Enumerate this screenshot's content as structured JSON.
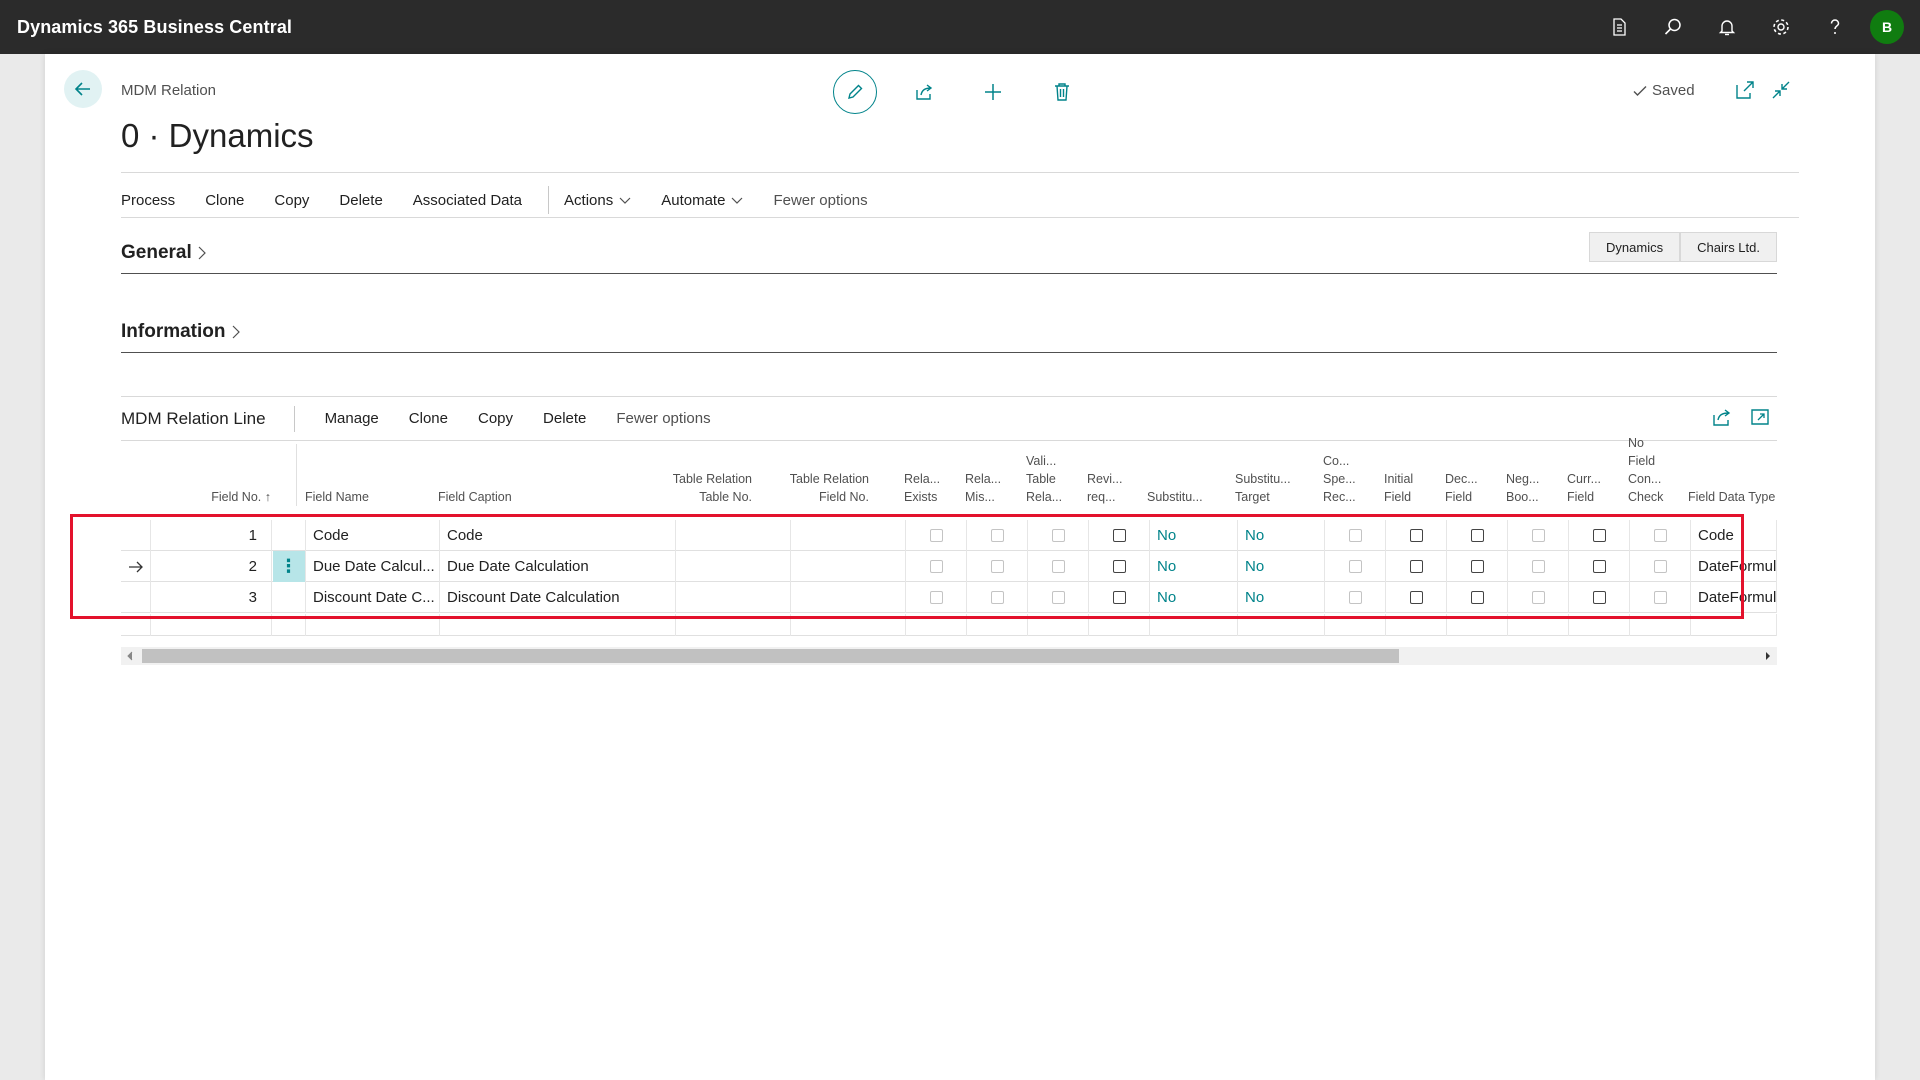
{
  "app": {
    "title": "Dynamics 365 Business Central",
    "user_initial": "B"
  },
  "appbar_icons": [
    "document-icon",
    "search-icon",
    "bell-icon",
    "gear-icon",
    "help-icon"
  ],
  "page": {
    "caption": "MDM Relation",
    "title": "0 · Dynamics",
    "status": "Saved"
  },
  "actions": [
    "Process",
    "Clone",
    "Copy",
    "Delete",
    "Associated Data"
  ],
  "menus": {
    "actions": "Actions",
    "automate": "Automate",
    "fewer": "Fewer options"
  },
  "sections": {
    "general": "General",
    "information": "Information"
  },
  "companies": [
    "Dynamics",
    "Chairs Ltd."
  ],
  "lines": {
    "title": "MDM Relation Line",
    "actions": [
      "Manage",
      "Clone",
      "Copy",
      "Delete"
    ],
    "fewer": "Fewer options",
    "headers": {
      "field_no": "Field No.",
      "field_name": "Field Name",
      "field_caption": "Field Caption",
      "tr_table_1": "Table Relation",
      "tr_table_2": "Table No.",
      "tr_field_1": "Table Relation",
      "tr_field_2": "Field No.",
      "rel_exists_1": "Rela...",
      "rel_exists_2": "Exists",
      "rel_mis_1": "Rela...",
      "rel_mis_2": "Mis...",
      "vali_1": "Vali...",
      "vali_2": "Table",
      "vali_3": "Rela...",
      "revi_1": "Revi...",
      "revi_2": "req...",
      "substitu": "Substitu...",
      "subst_target_1": "Substitu...",
      "subst_target_2": "Target",
      "co_1": "Co...",
      "co_2": "Spe...",
      "co_3": "Rec...",
      "initial_1": "Initial",
      "initial_2": "Field",
      "dec_1": "Dec...",
      "dec_2": "Field",
      "neg_1": "Neg...",
      "neg_2": "Boo...",
      "curr_1": "Curr...",
      "curr_2": "Field",
      "nofield_1": "No",
      "nofield_2": "Field",
      "nofield_3": "Con...",
      "nofield_4": "Check",
      "data_type": "Field Data Type"
    },
    "rows": [
      {
        "field_no": "1",
        "field_name": "Code",
        "field_caption": "Code",
        "substitute": "No",
        "subst_target": "No",
        "data_type": "Code"
      },
      {
        "field_no": "2",
        "field_name": "Due Date Calcul...",
        "field_caption": "Due Date Calculation",
        "substitute": "No",
        "subst_target": "No",
        "data_type": "DateFormula"
      },
      {
        "field_no": "3",
        "field_name": "Discount Date C...",
        "field_caption": "Discount Date Calculation",
        "substitute": "No",
        "subst_target": "No",
        "data_type": "DateFormula"
      }
    ]
  },
  "colors": {
    "accent": "#00838a",
    "appbar": "#2b2b2b",
    "highlight": "#e3122c",
    "avatar": "#107c10"
  }
}
